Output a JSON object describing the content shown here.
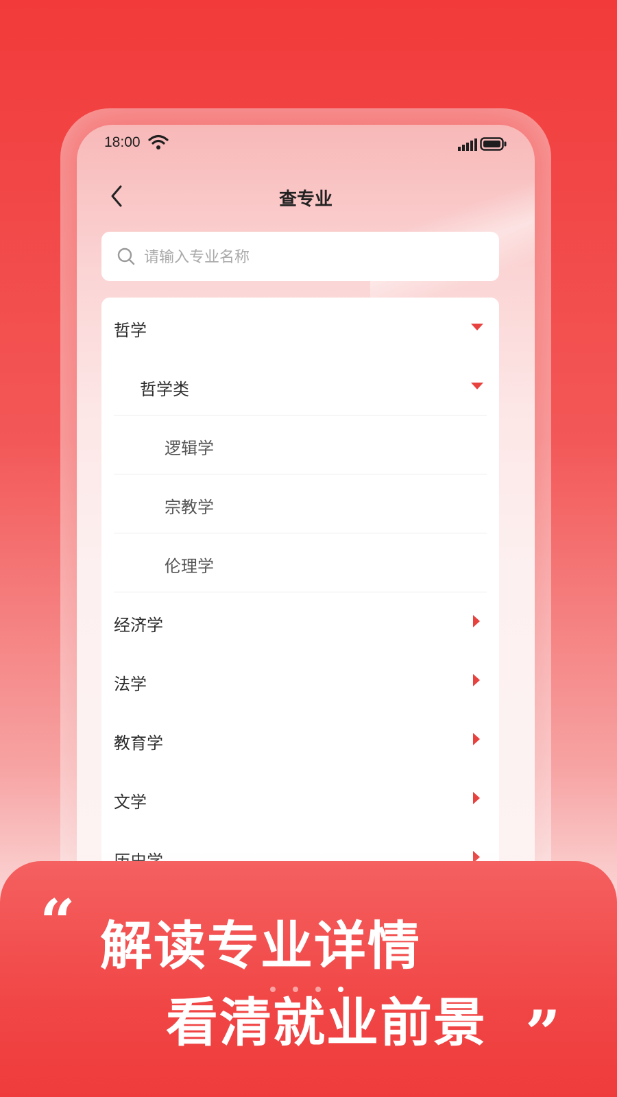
{
  "status_bar": {
    "time": "18:00",
    "icons": [
      "wifi-icon",
      "signal-icon",
      "battery-icon"
    ]
  },
  "nav": {
    "title": "查专业",
    "back_icon": "chevron-left-icon"
  },
  "search": {
    "placeholder": "请输入专业名称",
    "value": "",
    "icon": "search-icon"
  },
  "list": {
    "items": [
      {
        "label": "哲学",
        "state": "expanded"
      },
      {
        "label": "哲学类",
        "state": "expanded"
      },
      {
        "label": "逻辑学"
      },
      {
        "label": "宗教学"
      },
      {
        "label": "伦理学"
      },
      {
        "label": "经济学",
        "state": "collapsed"
      },
      {
        "label": "法学",
        "state": "collapsed"
      },
      {
        "label": "教育学",
        "state": "collapsed"
      },
      {
        "label": "文学",
        "state": "collapsed"
      },
      {
        "label": "历史学",
        "state": "collapsed"
      }
    ]
  },
  "banner": {
    "quote_open": "“",
    "line1": "解读专业详情",
    "line2": "看清就业前景",
    "quote_close": "”"
  },
  "colors": {
    "accent": "#e8423f",
    "background_top": "#f23a3a",
    "text_primary": "#2a2a2a"
  }
}
